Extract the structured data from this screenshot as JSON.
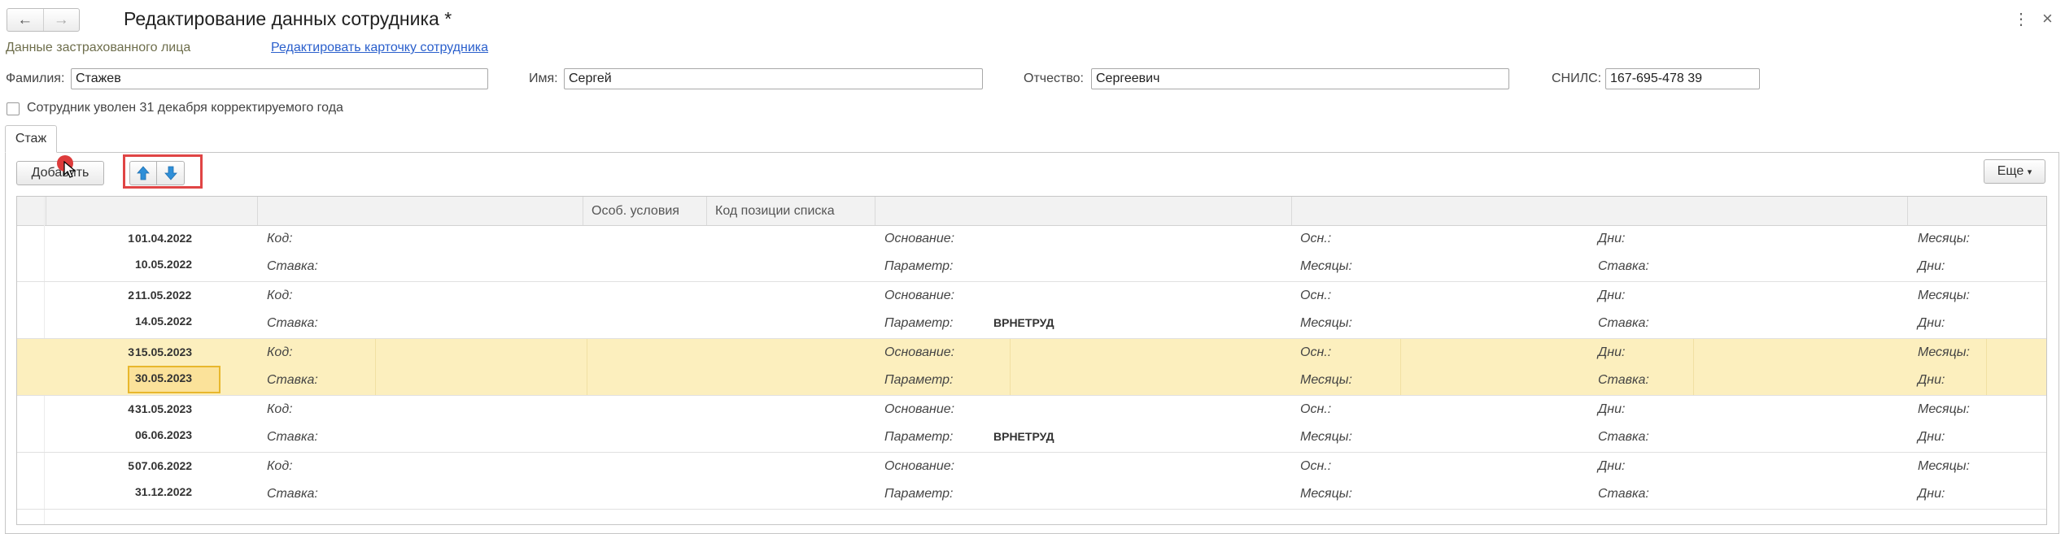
{
  "header": {
    "title": "Редактирование данных сотрудника *",
    "back_icon": "←",
    "forward_icon": "→",
    "more_icon": "⋮",
    "close_icon": "×"
  },
  "subheader": {
    "label": "Данные застрахованного лица",
    "link": "Редактировать карточку сотрудника"
  },
  "fields": {
    "lastname_label": "Фамилия:",
    "lastname_value": "Стажев",
    "firstname_label": "Имя:",
    "firstname_value": "Сергей",
    "patronymic_label": "Отчество:",
    "patronymic_value": "Сергеевич",
    "snils_label": "СНИЛС:",
    "snils_value": "167-695-478 39"
  },
  "dismissed": {
    "label": "Сотрудник уволен 31 декабря корректируемого года",
    "checked": false
  },
  "tabs": [
    {
      "label": "Стаж"
    }
  ],
  "toolbar": {
    "add_label": "Добавить",
    "more_label": "Еще",
    "more_arrow": "▾"
  },
  "grid": {
    "columns": [
      "",
      "",
      "Особ. условия",
      "Код позиции списка",
      "",
      ""
    ],
    "field_labels": {
      "code": "Код:",
      "rate": "Ставка:",
      "basis": "Основание:",
      "param": "Параметр:",
      "osn": "Осн.:",
      "months_a": "Месяцы:",
      "days_a": "Дни:",
      "rate_b": "Ставка:",
      "months_b": "Месяцы:",
      "days_b": "Дни:"
    },
    "rows": [
      {
        "num": "1",
        "start": "01.04.2022",
        "end": "10.05.2022",
        "param": "",
        "selected": false
      },
      {
        "num": "2",
        "start": "11.05.2022",
        "end": "14.05.2022",
        "param": "ВРНЕТРУД",
        "selected": false
      },
      {
        "num": "3",
        "start": "15.05.2023",
        "end": "30.05.2023",
        "param": "",
        "selected": true
      },
      {
        "num": "4",
        "start": "31.05.2023",
        "end": "06.06.2023",
        "param": "ВРНЕТРУД",
        "selected": false
      },
      {
        "num": "5",
        "start": "07.06.2022",
        "end": "31.12.2022",
        "param": "",
        "selected": false
      }
    ]
  },
  "colors": {
    "selected_row": "#fcefbe",
    "selected_cell": "#fbe29a",
    "highlight_box": "#e04545",
    "arrow_blue": "#2f8fd8",
    "link": "#2a5fcc"
  }
}
